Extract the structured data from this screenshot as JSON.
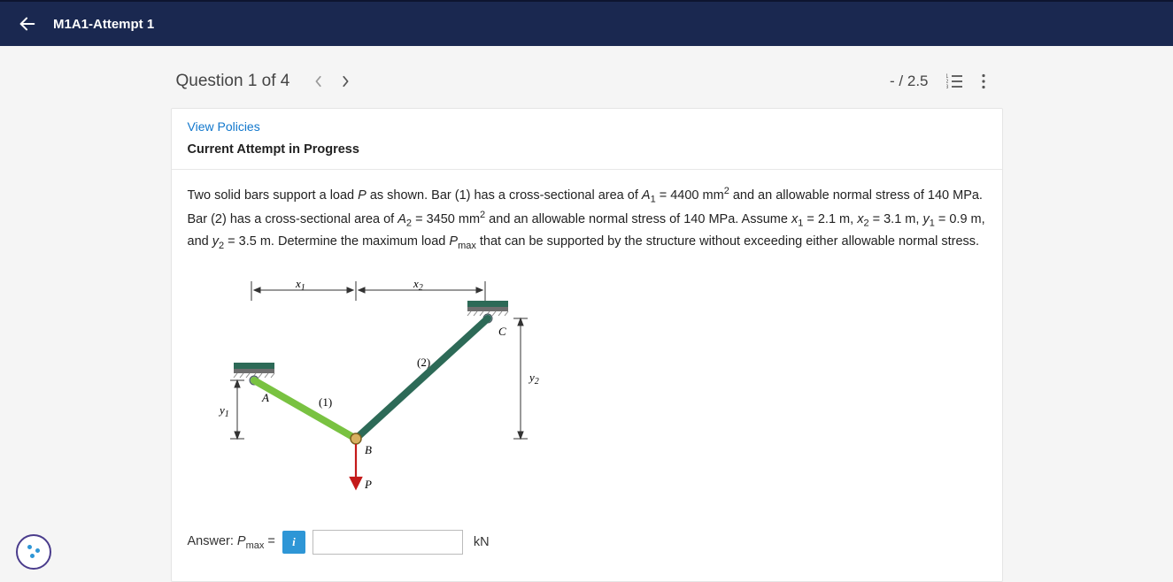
{
  "header": {
    "title": "M1A1-Attempt 1"
  },
  "question": {
    "label": "Question 1 of 4",
    "score": "- / 2.5"
  },
  "card": {
    "policies_link": "View Policies",
    "attempt_status": "Current Attempt in Progress"
  },
  "problem": {
    "A1": "4400",
    "sigma1": "140",
    "A2": "3450",
    "sigma2": "140",
    "x1": "2.1",
    "x2": "3.1",
    "y1": "0.9",
    "y2": "3.5"
  },
  "figure": {
    "labels": {
      "x1": "x",
      "x2": "x",
      "y1": "y",
      "y2": "y",
      "A": "A",
      "B": "B",
      "C": "C",
      "P": "P",
      "bar1": "(1)",
      "bar2": "(2)"
    }
  },
  "answer": {
    "label_prefix": "Answer:",
    "symbol": "P",
    "subscript": "max",
    "equals": "=",
    "unit": "kN",
    "value": ""
  }
}
